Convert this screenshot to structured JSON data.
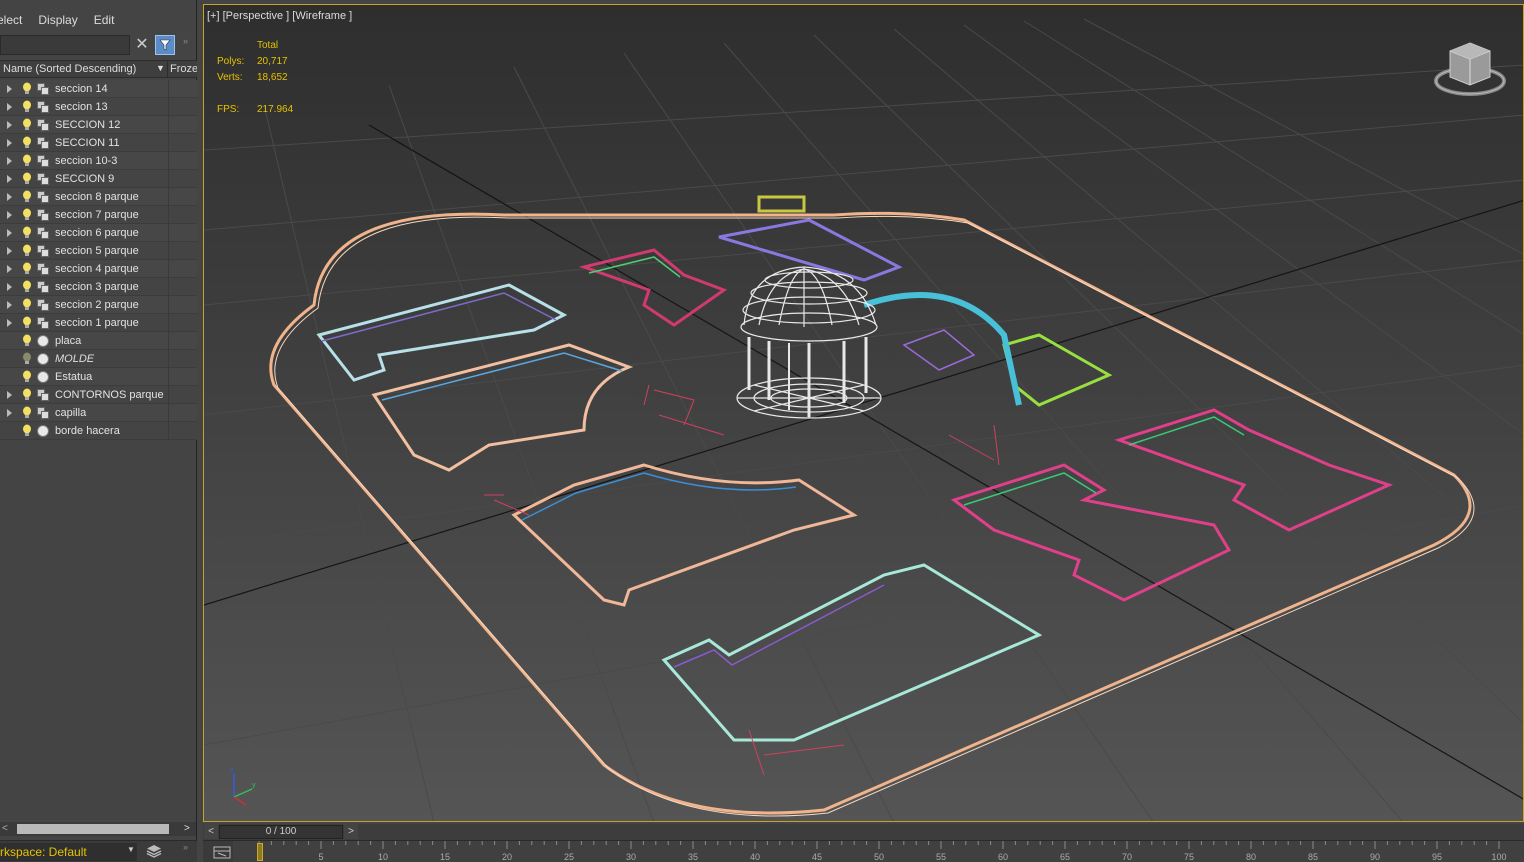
{
  "menu": {
    "items": [
      "elect",
      "Display",
      "Edit"
    ]
  },
  "explorer": {
    "search_value": "",
    "column_name": "Name (Sorted Descending)",
    "column_frozen": "Froze",
    "items": [
      {
        "label": "seccion 14",
        "type": "group",
        "italic": false
      },
      {
        "label": "seccion 13",
        "type": "group",
        "italic": false
      },
      {
        "label": "SECCION 12",
        "type": "group",
        "italic": false
      },
      {
        "label": "SECCION 11",
        "type": "group",
        "italic": false
      },
      {
        "label": "seccion 10-3",
        "type": "group",
        "italic": false
      },
      {
        "label": "SECCION 9",
        "type": "group",
        "italic": false
      },
      {
        "label": "seccion 8 parque",
        "type": "group",
        "italic": false
      },
      {
        "label": "seccion 7 parque",
        "type": "group",
        "italic": false
      },
      {
        "label": "seccion 6 parque",
        "type": "group",
        "italic": false
      },
      {
        "label": "seccion 5 parque",
        "type": "group",
        "italic": false
      },
      {
        "label": "seccion 4 parque",
        "type": "group",
        "italic": false
      },
      {
        "label": "seccion 3 parque",
        "type": "group",
        "italic": false
      },
      {
        "label": "seccion 2 parque",
        "type": "group",
        "italic": false
      },
      {
        "label": "seccion 1 parque",
        "type": "group",
        "italic": false
      },
      {
        "label": "placa",
        "type": "object",
        "italic": false
      },
      {
        "label": "MOLDE",
        "type": "object",
        "italic": true
      },
      {
        "label": "Estatua",
        "type": "object",
        "italic": false
      },
      {
        "label": "CONTORNOS parque",
        "type": "group",
        "italic": false
      },
      {
        "label": "capilla",
        "type": "group",
        "italic": false
      },
      {
        "label": "borde hacera",
        "type": "object",
        "italic": false
      }
    ]
  },
  "workspace": {
    "label": "rkspace: Default"
  },
  "viewport": {
    "label": "[+] [Perspective ] [Wireframe ]",
    "stats": {
      "header": "Total",
      "polys_label": "Polys:",
      "polys_value": "20,717",
      "verts_label": "Verts:",
      "verts_value": "18,652",
      "fps_label": "FPS:",
      "fps_value": "217.964"
    }
  },
  "timeline": {
    "frame_display": "0 / 100",
    "ticks": [
      "5",
      "10",
      "15",
      "20",
      "25",
      "30",
      "35",
      "40",
      "45",
      "50",
      "55",
      "60",
      "65",
      "70",
      "75",
      "80",
      "85",
      "90",
      "95",
      "100"
    ]
  },
  "colors": {
    "accent_yellow": "#e6c200",
    "viewport_border": "#c9a227",
    "filter_blue": "#5b8cc7"
  }
}
